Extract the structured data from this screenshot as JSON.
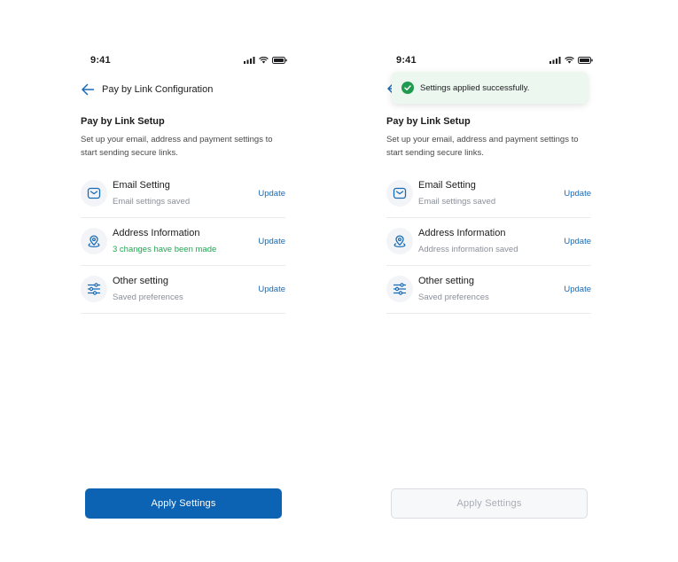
{
  "colors": {
    "accent": "#0d63b3",
    "link": "#1a6bb5",
    "success": "#22a652",
    "toast_bg": "#ecf7f0",
    "muted": "#8a8f98"
  },
  "screens": [
    {
      "status_time": "9:41",
      "header_title": "Pay by Link Configuration",
      "section_title": "Pay by Link Setup",
      "section_desc": "Set up your email, address and payment settings to start sending secure links.",
      "items": [
        {
          "icon": "mail-icon",
          "title": "Email Setting",
          "subtitle": "Email settings saved",
          "action": "Update"
        },
        {
          "icon": "location-pin-icon",
          "title": "Address Information",
          "subtitle": "3 changes have been made",
          "action": "Update"
        },
        {
          "icon": "sliders-icon",
          "title": "Other setting",
          "subtitle": "Saved preferences",
          "action": "Update"
        }
      ],
      "apply_label": "Apply Settings"
    },
    {
      "status_time": "9:41",
      "toast_text": "Settings applied successfully.",
      "section_title": "Pay by Link Setup",
      "section_desc": "Set up your email, address and payment settings to start sending secure links.",
      "items": [
        {
          "icon": "mail-icon",
          "title": "Email Setting",
          "subtitle": "Email settings saved",
          "action": "Update"
        },
        {
          "icon": "location-pin-icon",
          "title": "Address Information",
          "subtitle": "Address information saved",
          "action": "Update"
        },
        {
          "icon": "sliders-icon",
          "title": "Other setting",
          "subtitle": "Saved preferences",
          "action": "Update"
        }
      ],
      "apply_label": "Apply Settings"
    }
  ]
}
